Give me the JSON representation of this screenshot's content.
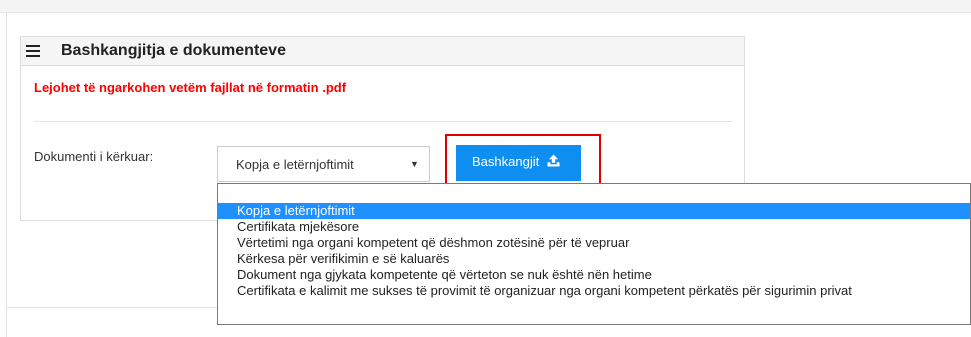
{
  "panel": {
    "title": "Bashkangjitja e dokumenteve",
    "icon": "list-icon",
    "warning": "Lejohet të ngarkohen vetëm fajllat në formatin .pdf",
    "warning_color": "#ff0000"
  },
  "form": {
    "document_label": "Dokumenti i kërkuar:",
    "select_value": "Kopja e letërnjoftimit",
    "attach_button_label": "Bashkangjit",
    "attach_button_color": "#0f8ef2",
    "highlight_color": "#e00000"
  },
  "dropdown": {
    "selected_color": "#1e90ff",
    "options": [
      "Kopja e letërnjoftimit",
      "Certifikata mjekësore",
      "Vërtetimi nga organi kompetent që dëshmon zotësinë për të vepruar",
      "Kërkesa për verifikimin e së kaluarës",
      "Dokument nga gjykata kompetente që vërteton se nuk është nën hetime",
      "Certifikata e kalimit me sukses të provimit të organizuar nga organi kompetent përkatës për sigurimin privat"
    ]
  }
}
